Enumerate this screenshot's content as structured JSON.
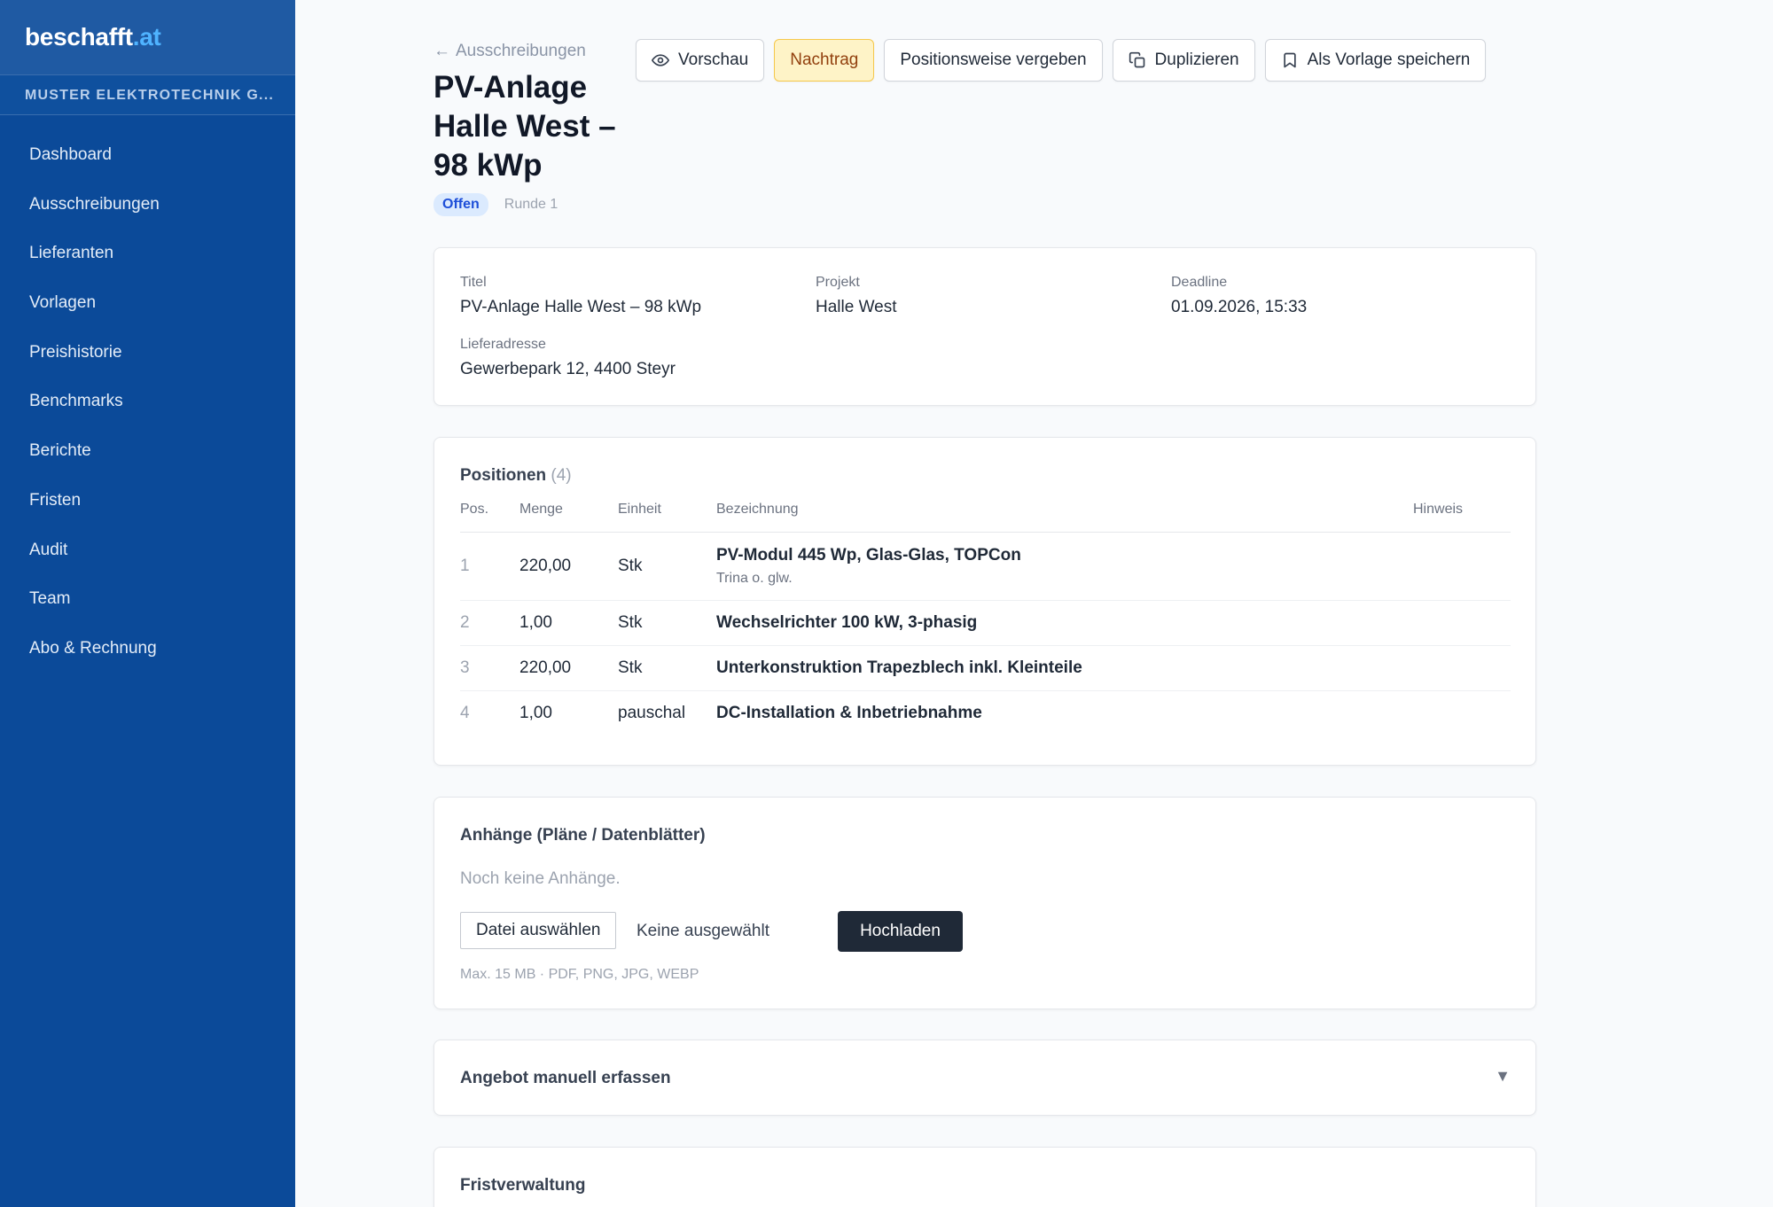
{
  "brand": {
    "name": "beschafft",
    "tld": ".at"
  },
  "org": {
    "name": "MUSTER ELEKTROTECHNIK G..."
  },
  "sidebar": {
    "items": [
      {
        "label": "Dashboard"
      },
      {
        "label": "Ausschreibungen"
      },
      {
        "label": "Lieferanten"
      },
      {
        "label": "Vorlagen"
      },
      {
        "label": "Preishistorie"
      },
      {
        "label": "Benchmarks"
      },
      {
        "label": "Berichte"
      },
      {
        "label": "Fristen"
      },
      {
        "label": "Audit"
      },
      {
        "label": "Team"
      },
      {
        "label": "Abo & Rechnung"
      }
    ]
  },
  "header": {
    "back_arrow": "←",
    "back_label": "Ausschreibungen",
    "title": "PV-Anlage Halle West – 98 kWp",
    "status": "Offen",
    "round": "Runde 1"
  },
  "actions": {
    "preview": {
      "label": "Vorschau",
      "icon": "eye-icon"
    },
    "addendum": {
      "label": "Nachtrag"
    },
    "award_by_position": {
      "label": "Positionsweise vergeben"
    },
    "duplicate": {
      "label": "Duplizieren",
      "icon": "copy-icon"
    },
    "save_template": {
      "label": "Als Vorlage speichern",
      "icon": "bookmark-icon"
    }
  },
  "info": {
    "title_label": "Titel",
    "title_value": "PV-Anlage Halle West – 98 kWp",
    "project_label": "Projekt",
    "project_value": "Halle West",
    "deadline_label": "Deadline",
    "deadline_value": "01.09.2026, 15:33",
    "address_label": "Lieferadresse",
    "address_value": "Gewerbepark 12, 4400 Steyr"
  },
  "positions": {
    "title": "Positionen",
    "count": "(4)",
    "columns": {
      "pos": "Pos.",
      "qty": "Menge",
      "unit": "Einheit",
      "desc": "Bezeichnung",
      "note": "Hinweis"
    },
    "rows": [
      {
        "pos": "1",
        "qty": "220,00",
        "unit": "Stk",
        "desc": "PV-Modul 445 Wp, Glas-Glas, TOPCon",
        "sub": "Trina o. glw.",
        "note": ""
      },
      {
        "pos": "2",
        "qty": "1,00",
        "unit": "Stk",
        "desc": "Wechselrichter 100 kW, 3-phasig",
        "sub": "",
        "note": ""
      },
      {
        "pos": "3",
        "qty": "220,00",
        "unit": "Stk",
        "desc": "Unterkonstruktion Trapezblech inkl. Kleinteile",
        "sub": "",
        "note": ""
      },
      {
        "pos": "4",
        "qty": "1,00",
        "unit": "pauschal",
        "desc": "DC-Installation & Inbetriebnahme",
        "sub": "",
        "note": ""
      }
    ]
  },
  "attachments": {
    "title": "Anhänge (Pläne / Datenblätter)",
    "empty": "Noch keine Anhänge.",
    "choose_label": "Datei auswählen",
    "file_status": "Keine ausgewählt",
    "upload_label": "Hochladen",
    "hint": "Max. 15 MB · PDF, PNG, JPG, WEBP"
  },
  "manual_offer": {
    "title": "Angebot manuell erfassen",
    "caret": "▼"
  },
  "deadlines": {
    "title": "Fristverwaltung"
  },
  "colors": {
    "sidebar": "#0b4a99",
    "accent": "#4fb3ff",
    "status_bg": "#dbeafe",
    "status_fg": "#1d4ed8",
    "warn_bg": "#fef3c7",
    "primary_dark": "#1f2937"
  }
}
